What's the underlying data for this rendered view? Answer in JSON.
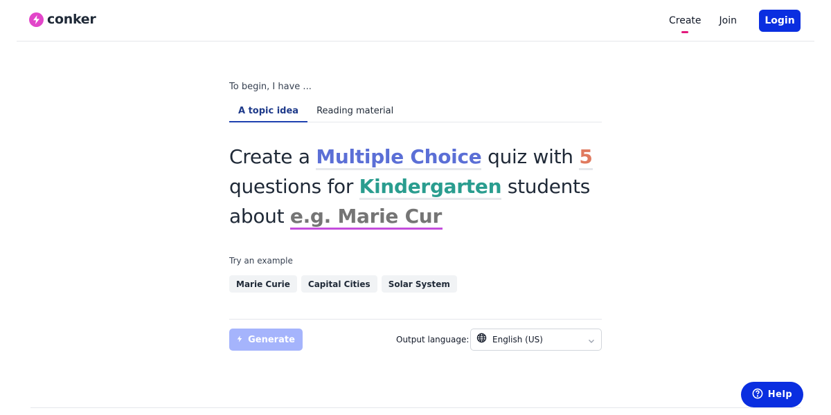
{
  "brand": {
    "name": "conker",
    "accent": "#e246c9",
    "icon": "lightning-icon"
  },
  "nav": {
    "create_label": "Create",
    "join_label": "Join",
    "login_label": "Login"
  },
  "intro": "To begin, I have ...",
  "tabs": [
    {
      "label": "A topic idea",
      "active": true
    },
    {
      "label": "Reading material",
      "active": false
    }
  ],
  "sentence": {
    "part1": "Create a",
    "quiz_type": "Multiple Choice",
    "part2": "quiz with",
    "question_count": "5",
    "part3": "questions for",
    "grade": "Kindergarten",
    "part4": "students",
    "part5": "about",
    "topic_placeholder": "e.g. Marie Curie",
    "topic_value": ""
  },
  "examples": {
    "label": "Try an example",
    "items": [
      "Marie Curie",
      "Capital Cities",
      "Solar System"
    ]
  },
  "generate_label": "Generate",
  "output_language": {
    "label": "Output language:",
    "value": "English (US)",
    "icon": "globe-icon"
  },
  "help_label": "Help",
  "colors": {
    "primary": "#0a2ee0",
    "quiz_type": "#5b6fd6",
    "question_count": "#e07a5f",
    "grade": "#2a9d8f",
    "topic_underline": "#c44ddc",
    "generate_disabled": "#a5b4fc"
  }
}
